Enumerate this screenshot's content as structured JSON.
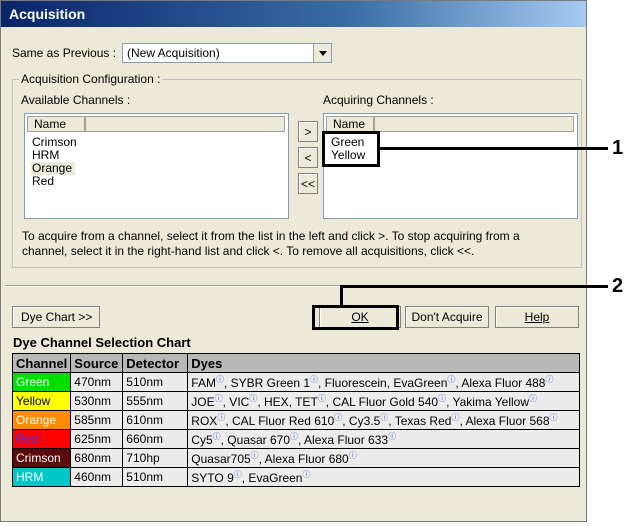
{
  "window": {
    "title": "Acquisition"
  },
  "same_as_previous": {
    "label": "Same as Previous :",
    "value": "(New Acquisition)"
  },
  "config": {
    "legend": "Acquisition Configuration :",
    "available_label": "Available Channels :",
    "acquiring_label": "Acquiring Channels :",
    "available_header": "Name",
    "acquiring_header": "Name",
    "available_channels": [
      "Crimson",
      "HRM",
      "Orange",
      "Red"
    ],
    "acquiring_channels": [
      "Green",
      "Yellow"
    ],
    "add_button": ">",
    "remove_button": "<",
    "remove_all_button": "<<",
    "help_text": "To acquire from a channel, select it from the list in the left and click >. To stop acquiring from a channel, select it in the right-hand list and click <. To remove all acquisitions, click <<."
  },
  "buttons": {
    "dye_chart": "Dye Chart >>",
    "ok": "OK",
    "dont_acquire": "Don't Acquire",
    "help": "Help"
  },
  "callouts": [
    "1",
    "2"
  ],
  "dye_chart": {
    "title": "Dye Channel Selection Chart",
    "headers": [
      "Channel",
      "Source",
      "Detector",
      "Dyes"
    ],
    "rows": [
      {
        "channel": "Green",
        "source": "470nm",
        "detector": "510nm",
        "dyes": "FAMⓘ, SYBR Green 1ⓘ, Fluorescein, EvaGreenⓘ, Alexa Fluor 488ⓘ",
        "bg": "#00e000",
        "fg": "#ffffff"
      },
      {
        "channel": "Yellow",
        "source": "530nm",
        "detector": "555nm",
        "dyes": "JOEⓘ, VICⓘ, HEX, TETⓘ, CAL Fluor Gold 540ⓘ, Yakima Yellowⓘ",
        "bg": "#ffff00",
        "fg": "#000000"
      },
      {
        "channel": "Orange",
        "source": "585nm",
        "detector": "610nm",
        "dyes": "ROXⓘ, CAL Fluor Red 610ⓘ, Cy3.5ⓘ, Texas Redⓘ, Alexa Fluor 568ⓘ",
        "bg": "#ff8c00",
        "fg": "#ffffff"
      },
      {
        "channel": "Red",
        "source": "625nm",
        "detector": "660nm",
        "dyes": "Cy5ⓘ, Quasar 670ⓘ, Alexa Fluor 633ⓘ",
        "bg": "#ff0000",
        "fg": "#3333ff"
      },
      {
        "channel": "Crimson",
        "source": "680nm",
        "detector": "710hp",
        "dyes": "Quasar705ⓘ, Alexa Fluor 680ⓘ",
        "bg": "#5a0a0a",
        "fg": "#ffffff"
      },
      {
        "channel": "HRM",
        "source": "460nm",
        "detector": "510nm",
        "dyes": "SYTO 9ⓘ, EvaGreenⓘ",
        "bg": "#00c8c8",
        "fg": "#ffffff"
      }
    ]
  }
}
